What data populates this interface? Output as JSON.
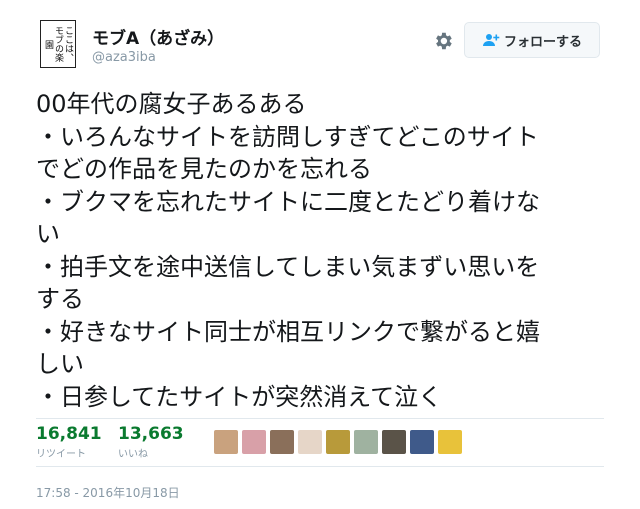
{
  "user": {
    "avatar_text": "ここは、モブの楽園",
    "display_name": "モブA（あざみ）",
    "handle": "@aza3iba"
  },
  "header": {
    "settings_icon": "gear-icon",
    "follow_label": "フォローする",
    "follow_icon": "person-plus-icon"
  },
  "tweet": {
    "lines": [
      "00年代の腐女子あるある",
      "・いろんなサイトを訪問しすぎてどこのサイト",
      "でどの作品を見たのかを忘れる",
      "・ブクマを忘れたサイトに二度とたどり着けな",
      "い",
      "・拍手文を途中送信してしまい気まずい思いを",
      "する",
      "・好きなサイト同士が相互リンクで繋がると嬉",
      "しい",
      "・日参してたサイトが突然消えて泣く"
    ]
  },
  "stats": {
    "retweets": "16,841",
    "retweets_label": "リツイート",
    "likes": "13,663",
    "likes_label": "いいね"
  },
  "likers": {
    "colors": [
      "#c9a27e",
      "#d8a0a8",
      "#8a6f5a",
      "#e6d6c8",
      "#b89a3a",
      "#9fb2a0",
      "#5a5348",
      "#3f5a8a",
      "#e8c23a"
    ]
  },
  "timestamp": "17:58 - 2016年10月18日",
  "colors": {
    "stat_number": "#0a7a2f",
    "muted": "#8899a6",
    "follow_icon": "#1da1f2"
  }
}
